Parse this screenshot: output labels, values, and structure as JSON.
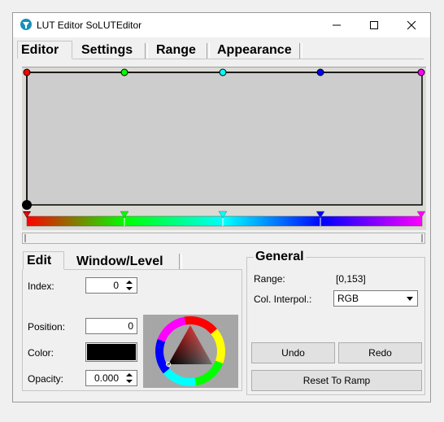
{
  "window": {
    "title": "LUT Editor SoLUTEditor",
    "controls": {
      "minimize": "minimize-icon",
      "maximize": "maximize-icon",
      "close": "close-icon"
    }
  },
  "main_tabs": [
    {
      "label": "Editor",
      "active": true
    },
    {
      "label": "Settings",
      "active": false
    },
    {
      "label": "Range",
      "active": false
    },
    {
      "label": "Appearance",
      "active": false
    }
  ],
  "editor": {
    "control_points": [
      {
        "color": "#ff0000"
      },
      {
        "color": "#00ff00"
      },
      {
        "color": "#00ffff"
      },
      {
        "color": "#0000ff"
      },
      {
        "color": "#ff00ff"
      }
    ],
    "selected_point_color": "#000000"
  },
  "edit_tabs": [
    {
      "label": "Edit",
      "active": true
    },
    {
      "label": "Window/Level",
      "active": false
    }
  ],
  "edit": {
    "index_label": "Index:",
    "index_value": "0",
    "position_label": "Position:",
    "position_value": "0",
    "color_label": "Color:",
    "color_value": "#000000",
    "opacity_label": "Opacity:",
    "opacity_value": "0.000"
  },
  "general": {
    "title": "General",
    "range_label": "Range:",
    "range_value": "[0,153]",
    "interp_label": "Col. Interpol.:",
    "interp_value": "RGB",
    "undo_label": "Undo",
    "redo_label": "Redo",
    "reset_label": "Reset To Ramp"
  }
}
